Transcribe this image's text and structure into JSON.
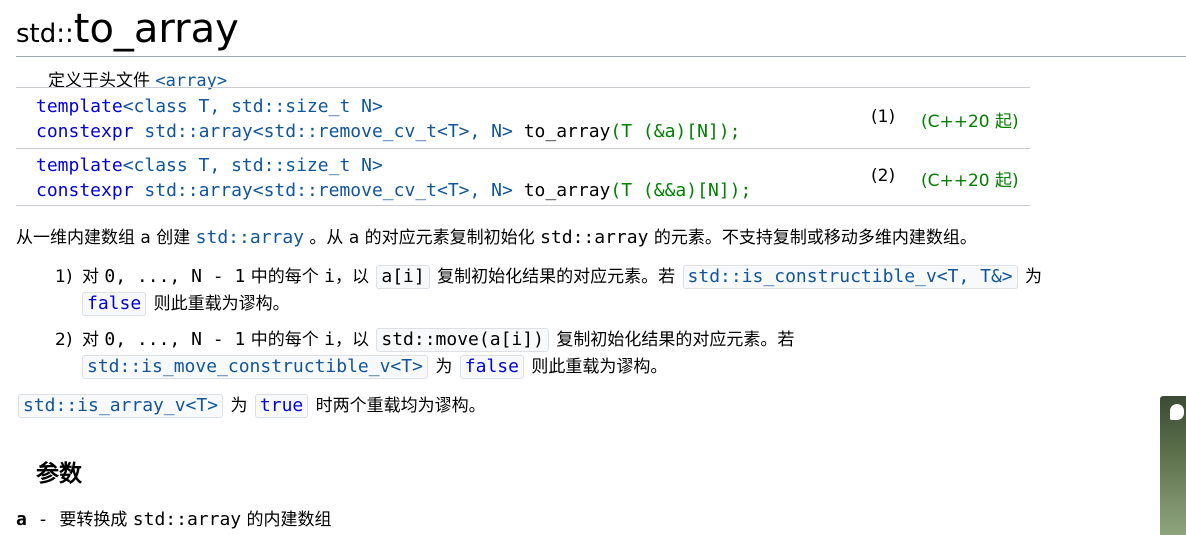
{
  "title": {
    "ns": "std::",
    "name": "to_array"
  },
  "header": {
    "label": "定义于头文件",
    "file": "<array>"
  },
  "decls": [
    {
      "line1": {
        "kw1": "template",
        "rest": "<class T, std::size_t N>"
      },
      "line2": {
        "kw": "constexpr",
        "type_a": "std::array<std::remove_cv_t<T>,",
        "n": " N>",
        "fn": " to_array",
        "params": "(T (&a)[N]);"
      },
      "num": "(1)",
      "ver": "(C++20 起)"
    },
    {
      "line1": {
        "kw1": "template",
        "rest": "<class T, std::size_t N>"
      },
      "line2": {
        "kw": "constexpr",
        "type_a": "std::array<std::remove_cv_t<T>,",
        "n": " N>",
        "fn": " to_array",
        "params": "(T (&&a)[N]);"
      },
      "num": "(2)",
      "ver": "(C++20 起)"
    }
  ],
  "intro": {
    "p1": "从一维内建数组 a 创建 ",
    "code1": "std::array",
    "p2": " 。从 a 的对应元素复制初始化 ",
    "code2": "std::array",
    "p3": " 的元素。不支持复制或移动多维内建数组。"
  },
  "item1": {
    "num": "1)",
    "t1": "对 ",
    "c1": "0, ..., N - 1",
    "t2": " 中的每个 ",
    "c2": "i",
    "t3": "，以 ",
    "chip1": "a[i]",
    "t4": " 复制初始化结果的对应元素。若 ",
    "chip2": "std::is_constructible_v<T, T&>",
    "t5": " 为",
    "chip3": "false",
    "t6": " 则此重载为谬构。"
  },
  "item2": {
    "num": "2)",
    "t1": "对 ",
    "c1": "0, ..., N - 1",
    "t2": " 中的每个 ",
    "c2": "i",
    "t3": "，以 ",
    "chip1": "std::move(a[i])",
    "t4": " 复制初始化结果的对应元素。若",
    "chip2": "std::is_move_constructible_v<T>",
    "t5": " 为 ",
    "chip3": "false",
    "t6": " 则此重载为谬构。"
  },
  "note": {
    "chip1": "std::is_array_v<T>",
    "t1": " 为 ",
    "chip2": "true",
    "t2": " 时两个重载均为谬构。"
  },
  "params": {
    "heading": "参数",
    "name": "a",
    "sep": " - ",
    "desc1": "要转换成 ",
    "code": "std::array",
    "desc2": " 的内建数组"
  },
  "colors": {
    "keyword": "#0000dd",
    "identifier": "#11559a",
    "version": "#008000",
    "rule": "#a2a9b1"
  },
  "icons": {
    "side_widget": "chat-bubble-icon"
  }
}
